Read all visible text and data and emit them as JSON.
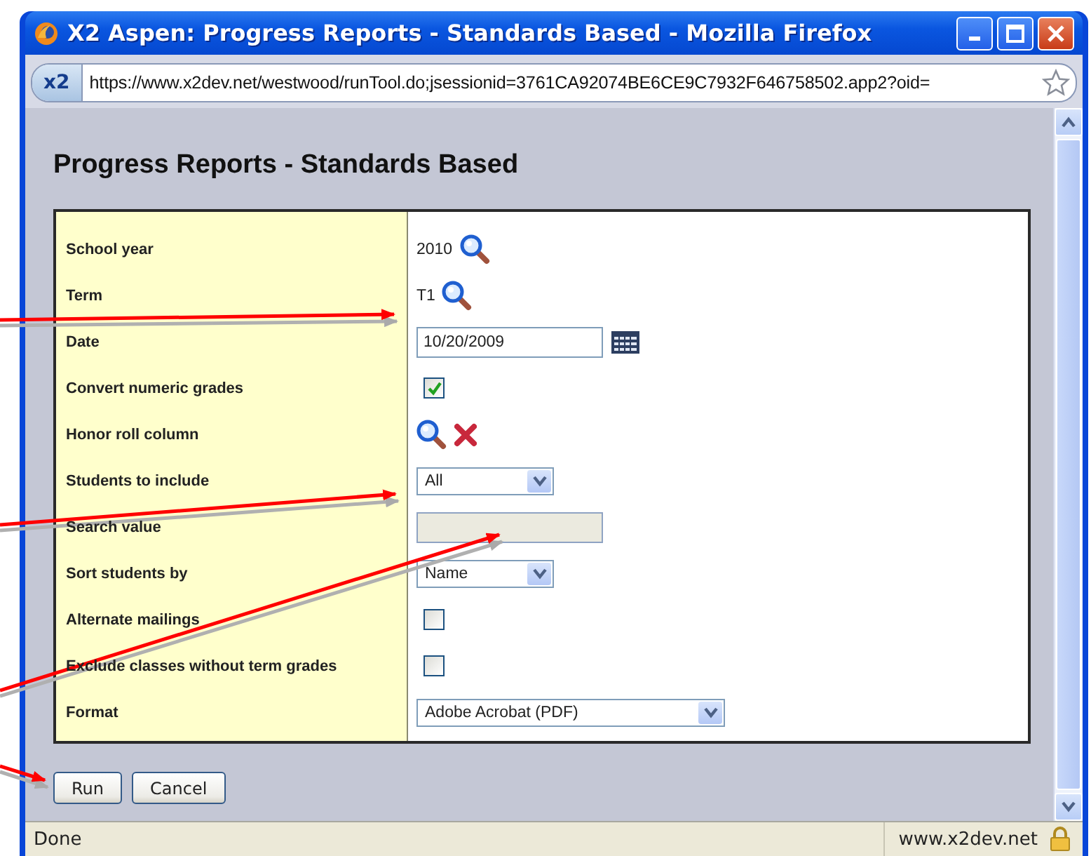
{
  "window": {
    "title": "X2 Aspen: Progress Reports - Standards Based - Mozilla Firefox"
  },
  "address_bar": {
    "site_badge": "x2",
    "url": "https://www.x2dev.net/westwood/runTool.do;jsessionid=3761CA92074BE6CE9C7932F646758502.app2?oid="
  },
  "page": {
    "heading": "Progress Reports - Standards Based"
  },
  "form": {
    "fields": [
      {
        "label": "School year",
        "kind": "lookup",
        "value": "2010"
      },
      {
        "label": "Term",
        "kind": "lookup",
        "value": "T1"
      },
      {
        "label": "Date",
        "kind": "date",
        "value": "10/20/2009"
      },
      {
        "label": "Convert numeric grades",
        "kind": "checkbox",
        "checked": true
      },
      {
        "label": "Honor roll column",
        "kind": "lookup_clear"
      },
      {
        "label": "Students to include",
        "kind": "select",
        "value": "All"
      },
      {
        "label": "Search value",
        "kind": "text",
        "disabled": true
      },
      {
        "label": "Sort students by",
        "kind": "select",
        "value": "Name"
      },
      {
        "label": "Alternate mailings",
        "kind": "checkbox",
        "checked": false
      },
      {
        "label": "Exclude classes without term grades",
        "kind": "checkbox",
        "checked": false
      },
      {
        "label": "Format",
        "kind": "select_wide",
        "value": "Adobe Acrobat (PDF)"
      }
    ]
  },
  "buttons": [
    "Run",
    "Cancel"
  ],
  "status_bar": {
    "text": "Done",
    "domain": "www.x2dev.net"
  }
}
